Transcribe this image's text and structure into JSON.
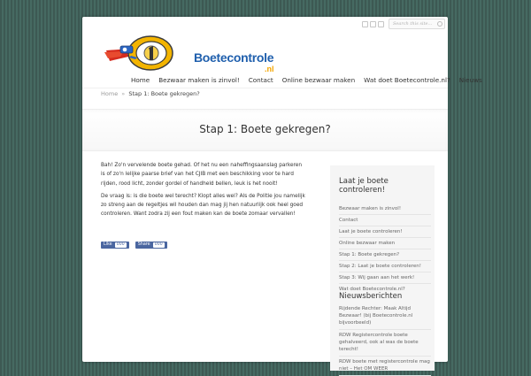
{
  "search": {
    "placeholder": "Search this site..."
  },
  "logo": {
    "text": "Boetecontrole",
    "suffix": ".nl",
    "icon": "speeding-camera-superhero-icon"
  },
  "nav": {
    "items": [
      "Home",
      "Bezwaar maken is zinvol!",
      "Contact",
      "Online bezwaar maken",
      "Wat doet Boetecontrole.nl?",
      "Nieuws"
    ]
  },
  "breadcrumb": {
    "home": "Home",
    "separator": "»",
    "current": "Stap 1: Boete gekregen?"
  },
  "page": {
    "title": "Stap 1: Boete gekregen?"
  },
  "content": {
    "paragraph1": "Bah! Zo'n vervelende boete gehad. Of het nu een naheffingsaanslag parkeren is of zo'n lelijke paarse brief van het CJIB met een beschikking voor te hard rijden, rood licht, zonder gordel of handheld bellen, leuk is het nooit!",
    "paragraph2": "De vraag is: is die boete wel terecht? Klopt alles wel? Als de Politie jou namelijk zo streng aan de regeltjes wil houden dan mag jij hen natuurlijk ook heel goed controleren. Want zodra zij een fout maken kan de boete zomaar vervallen!",
    "like_label": "Like",
    "like_count": "000",
    "share_label": "Share",
    "share_count": "000"
  },
  "sidebar": {
    "widget1_title": "Laat je boete controleren!",
    "links": [
      "Bezwaar maken is zinvol!",
      "Contact",
      "Laat je boete controleren!",
      "Online bezwaar maken",
      "Stap 1: Boete gekregen?",
      "Stap 2: Laat je boete controleren!",
      "Stap 3: Wij gaan aan het werk!",
      "Wat doet Boetecontrole.nl?"
    ],
    "widget2_title": "Nieuwsberichten",
    "news": [
      "Rijdende Rechter: Maak Altijd Bezwaar! (bij Boetecontrole.nl bijvoorbeeld)",
      "RDW Registercontrole boete gehalveerd, ook al was de boete terecht!",
      "RDW boete met registercontrole mag niet – Het OM WEER"
    ]
  },
  "colors": {
    "brand_blue": "#1f5fad",
    "brand_orange": "#f4a500",
    "facebook": "#4a66a0"
  }
}
